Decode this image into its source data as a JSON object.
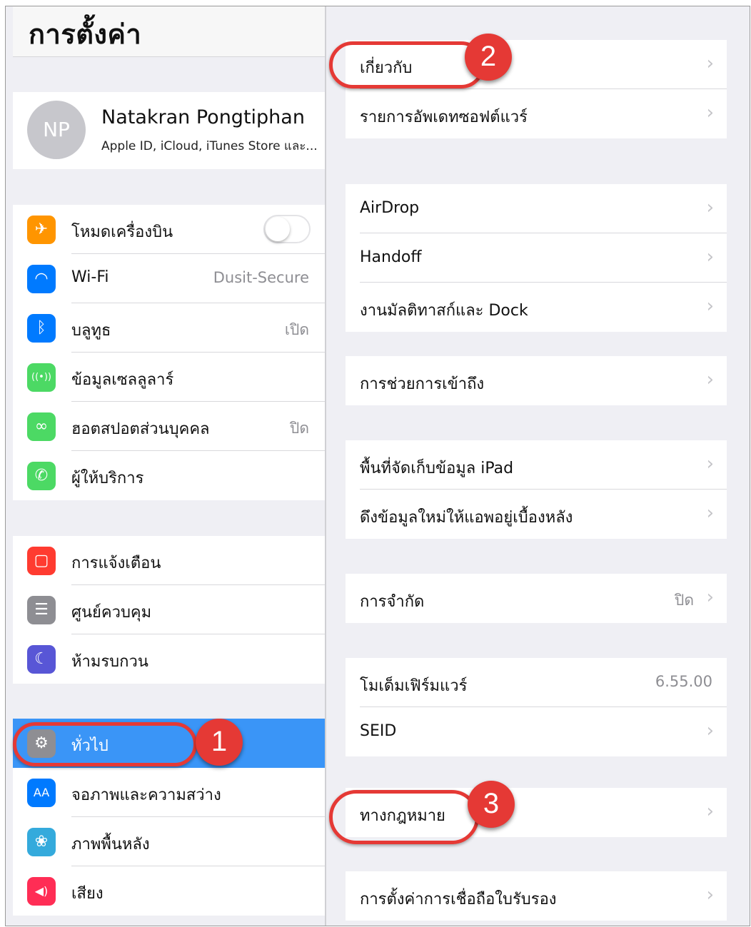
{
  "left_pane": {
    "title": "การตั้งค่า",
    "profile": {
      "initials": "NP",
      "name": "Natakran Pongtiphan",
      "subtitle": "Apple ID, iCloud, iTunes Store และ..."
    },
    "group1": [
      {
        "label": "โหมดเครื่องบิน",
        "icon": "airplane-icon",
        "icon_color": "#ff9500",
        "toggle": false
      },
      {
        "label": "Wi-Fi",
        "icon": "wifi-icon",
        "icon_color": "#007aff",
        "value": "Dusit-Secure"
      },
      {
        "label": "บลูทูธ",
        "icon": "bluetooth-icon",
        "icon_color": "#007aff",
        "value": "เปิด"
      },
      {
        "label": "ข้อมูลเซลลูลาร์",
        "icon": "cellular-icon",
        "icon_color": "#4cd964"
      },
      {
        "label": "ฮอตสปอตส่วนบุคคล",
        "icon": "hotspot-icon",
        "icon_color": "#4cd964",
        "value": "ปิด"
      },
      {
        "label": "ผู้ให้บริการ",
        "icon": "phone-icon",
        "icon_color": "#4cd964"
      }
    ],
    "group2": [
      {
        "label": "การแจ้งเตือน",
        "icon": "notifications-icon",
        "icon_color": "#ff3b30"
      },
      {
        "label": "ศูนย์ควบคุม",
        "icon": "control-center-icon",
        "icon_color": "#8e8e93"
      },
      {
        "label": "ห้ามรบกวน",
        "icon": "moon-icon",
        "icon_color": "#5856d6"
      }
    ],
    "group3": [
      {
        "label": "ทั่วไป",
        "icon": "gear-icon",
        "icon_color": "#8e8e93",
        "selected": true
      },
      {
        "label": "จอภาพและความสว่าง",
        "icon": "display-icon",
        "icon_color": "#007aff"
      },
      {
        "label": "ภาพพื้นหลัง",
        "icon": "wallpaper-icon",
        "icon_color": "#34aadc"
      },
      {
        "label": "เสียง",
        "icon": "sound-icon",
        "icon_color": "#ff2d55"
      }
    ]
  },
  "right_pane": {
    "groups": [
      [
        {
          "label": "เกี่ยวกับ"
        },
        {
          "label": "รายการอัพเดทซอฟต์แวร์"
        }
      ],
      [
        {
          "label": "AirDrop"
        },
        {
          "label": "Handoff"
        },
        {
          "label": "งานมัลติทาสก์และ Dock"
        }
      ],
      [
        {
          "label": "การช่วยการเข้าถึง"
        }
      ],
      [
        {
          "label": "พื้นที่จัดเก็บข้อมูล iPad"
        },
        {
          "label": "ดึงข้อมูลใหม่ให้แอพอยู่เบื้องหลัง"
        }
      ],
      [
        {
          "label": "การจำกัด",
          "value": "ปิด"
        }
      ],
      [
        {
          "label": "โมเด็มเฟิร์มแวร์",
          "value": "6.55.00",
          "no_chevron": true
        },
        {
          "label": "SEID"
        }
      ],
      [
        {
          "label": "ทางกฎหมาย"
        }
      ],
      [
        {
          "label": "การตั้งค่าการเชื่อถือใบรับรอง"
        }
      ]
    ]
  },
  "annotations": [
    "1",
    "2",
    "3"
  ],
  "colors": {
    "selection": "#3a95f7",
    "annotation": "#e53935",
    "background": "#efeff4"
  }
}
